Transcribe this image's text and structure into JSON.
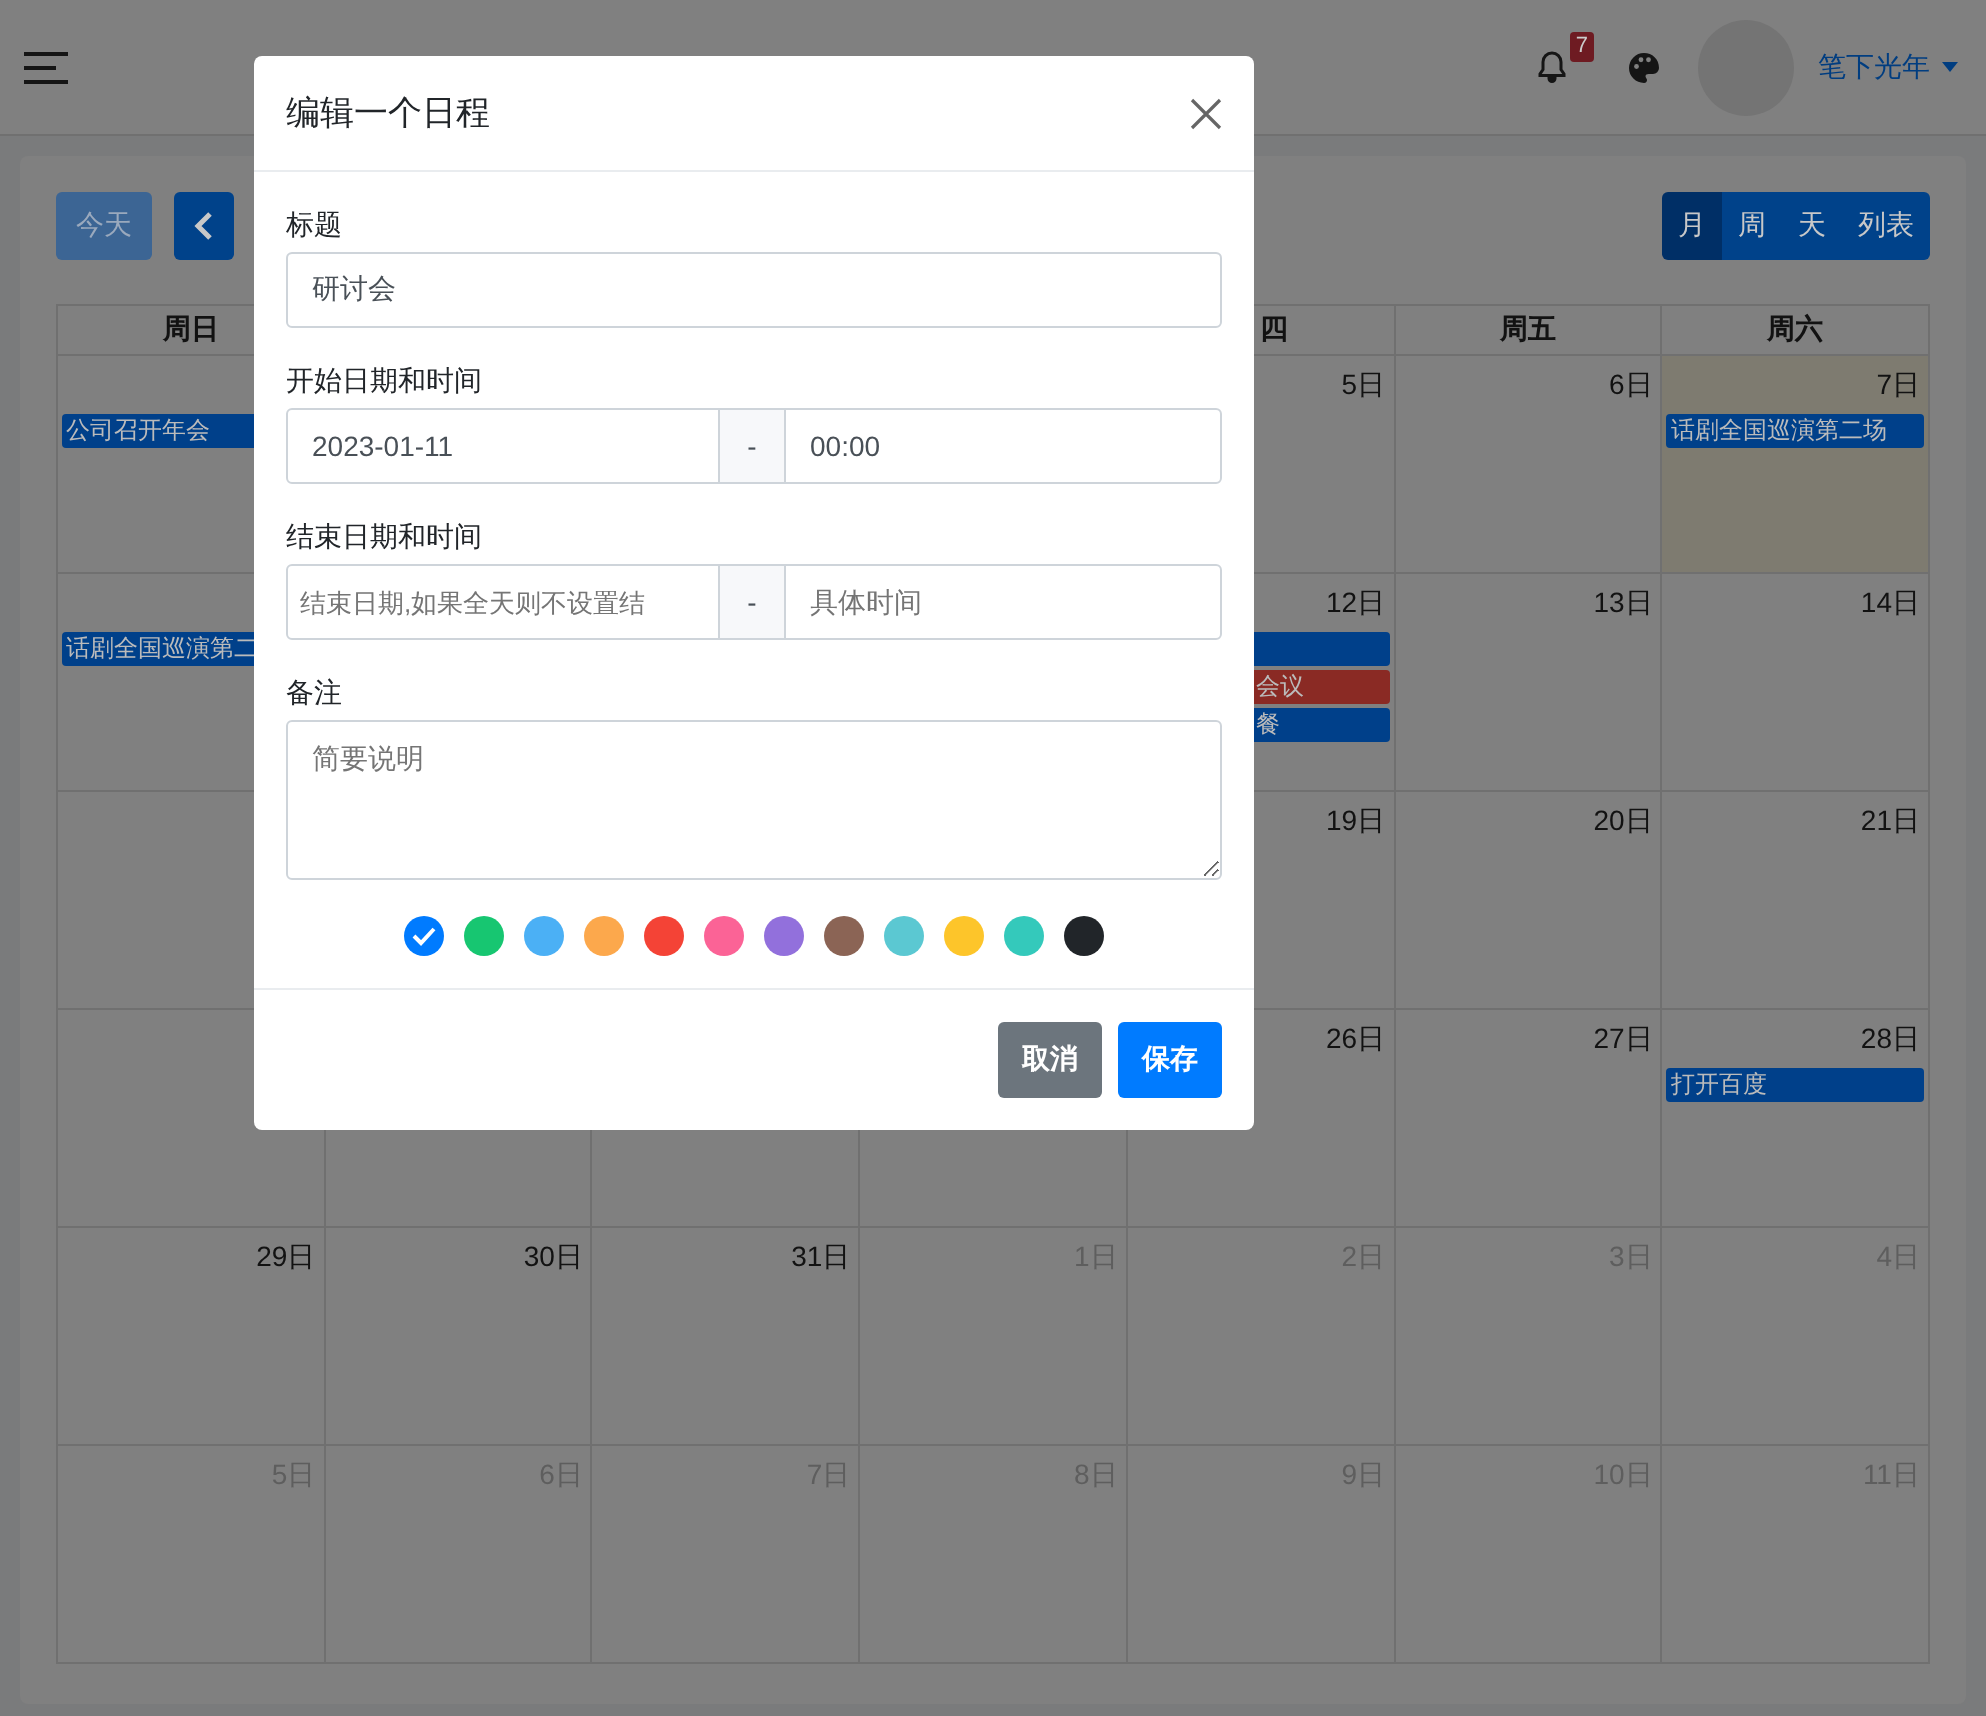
{
  "header": {
    "notifications": "7",
    "user": "笔下光年"
  },
  "toolbar": {
    "today": {
      "label": "今天",
      "disabled": true
    },
    "views": [
      {
        "label": "月",
        "selected": true
      },
      {
        "label": "周",
        "selected": false
      },
      {
        "label": "天",
        "selected": false
      },
      {
        "label": "列表",
        "selected": false
      }
    ]
  },
  "calendar": {
    "weekdays": [
      {
        "label": "周日"
      },
      {
        "label": "四"
      },
      {
        "label": "周五"
      },
      {
        "label": "周六"
      }
    ],
    "weeks": [
      {
        "days": [
          {
            "today": false,
            "events": [
              {
                "title": "公司召开年会",
                "color": "#00408a"
              }
            ]
          },
          {
            "day": "5日",
            "other_month": false,
            "today": false
          },
          {
            "day": "6日",
            "other_month": false,
            "today": false
          },
          {
            "day": "7日",
            "other_month": false,
            "today": true,
            "events": [
              {
                "title": "话剧全国巡演第二场",
                "color": "#00408a"
              }
            ]
          }
        ]
      },
      {
        "days": [
          {
            "today": false,
            "events": [
              {
                "title": "话剧全国巡演第二",
                "color": "#00408a"
              }
            ]
          },
          {
            "day": "12日",
            "other_month": false,
            "today": false,
            "events": [
              {
                "color": "#00408a"
              },
              {
                "title": "会议",
                "color": "#8a2a24"
              },
              {
                "title": "餐",
                "color": "#00408a"
              }
            ]
          },
          {
            "day": "13日",
            "other_month": false,
            "today": false
          },
          {
            "day": "14日",
            "other_month": false,
            "today": false
          }
        ]
      },
      {
        "days": [
          {
            "today": false
          },
          {
            "day": "19日",
            "other_month": false,
            "today": false
          },
          {
            "day": "20日",
            "other_month": false,
            "today": false
          },
          {
            "day": "21日",
            "other_month": false,
            "today": false
          }
        ]
      },
      {
        "days": [
          {
            "today": false
          },
          {
            "day": "26日",
            "other_month": false,
            "today": false
          },
          {
            "day": "27日",
            "other_month": false,
            "today": false
          },
          {
            "day": "28日",
            "other_month": false,
            "today": false,
            "events": [
              {
                "title": "打开百度",
                "color": "#00408a"
              }
            ]
          }
        ]
      },
      {
        "days": [
          {
            "day": "29日",
            "other_month": false,
            "today": false
          },
          {
            "day": "30日",
            "other_month": false,
            "today": false
          },
          {
            "day": "31日",
            "other_month": false,
            "today": false
          },
          {
            "day": "1日",
            "other_month": true,
            "today": false
          },
          {
            "day": "2日",
            "other_month": true,
            "today": false
          },
          {
            "day": "3日",
            "other_month": true,
            "today": false
          },
          {
            "day": "4日",
            "other_month": true,
            "today": false
          }
        ]
      },
      {
        "days": [
          {
            "day": "5日",
            "other_month": true,
            "today": false
          },
          {
            "day": "6日",
            "other_month": true,
            "today": false
          },
          {
            "day": "7日",
            "other_month": true,
            "today": false
          },
          {
            "day": "8日",
            "other_month": true,
            "today": false
          },
          {
            "day": "9日",
            "other_month": true,
            "today": false
          },
          {
            "day": "10日",
            "other_month": true,
            "today": false
          },
          {
            "day": "11日",
            "other_month": true,
            "today": false
          }
        ]
      }
    ]
  },
  "modal": {
    "title": "编辑一个日程",
    "title_field": {
      "label": "标题",
      "value": "研讨会"
    },
    "start": {
      "label": "开始日期和时间",
      "date": "2023-01-11",
      "separator": "-",
      "time": "00:00"
    },
    "end": {
      "label": "结束日期和时间",
      "date_placeholder": "结束日期,如果全天则不设置结",
      "separator": "-",
      "time_placeholder": "具体时间"
    },
    "note": {
      "label": "备注",
      "placeholder": "简要说明"
    },
    "colors": [
      {
        "color": "#007bff",
        "selected": true
      },
      {
        "color": "#17c671",
        "selected": false
      },
      {
        "color": "#4bb0f5",
        "selected": false
      },
      {
        "color": "#fca84c",
        "selected": false
      },
      {
        "color": "#f44336",
        "selected": false
      },
      {
        "color": "#fb6396",
        "selected": false
      },
      {
        "color": "#9270dc",
        "selected": false
      },
      {
        "color": "#8b6455",
        "selected": false
      },
      {
        "color": "#5bc8d2",
        "selected": false
      },
      {
        "color": "#fdc52a",
        "selected": false
      },
      {
        "color": "#34c9bb",
        "selected": false
      },
      {
        "color": "#212529",
        "selected": false
      }
    ],
    "buttons": [
      {
        "label": "取消",
        "kind": "secondary"
      },
      {
        "label": "保存",
        "kind": "primary"
      }
    ]
  }
}
